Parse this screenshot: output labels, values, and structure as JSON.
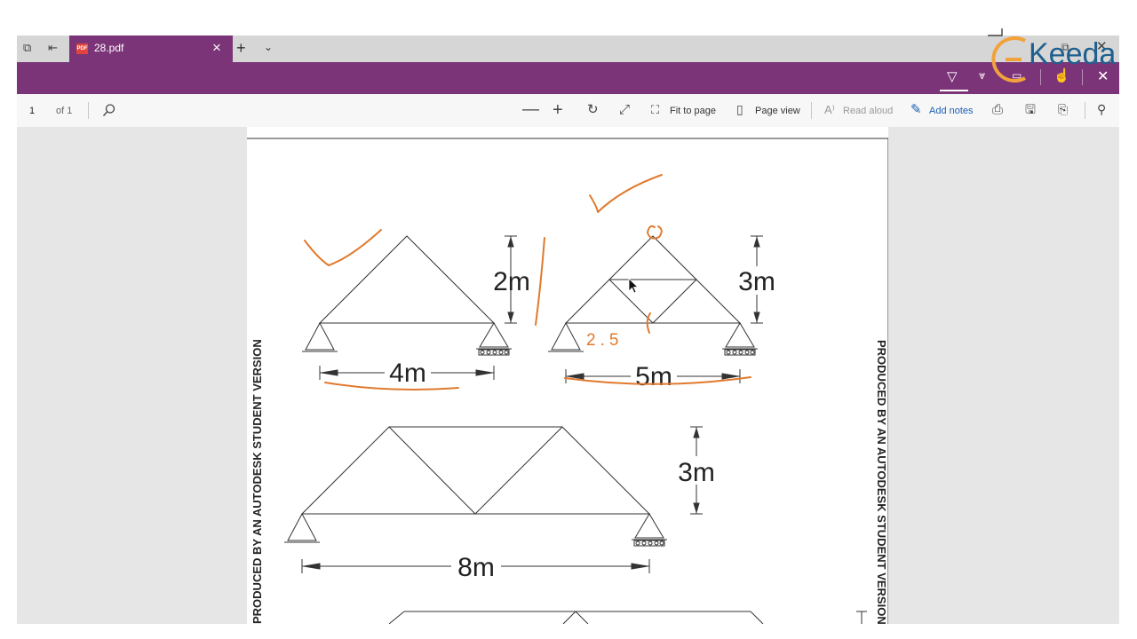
{
  "tab": {
    "title": "28.pdf",
    "pdf_badge": "PDF"
  },
  "toolbar": {
    "page_number": "1",
    "page_total": "of 1",
    "fit_to_page": "Fit to page",
    "page_view": "Page view",
    "read_aloud": "Read aloud",
    "add_notes": "Add notes"
  },
  "watermark": {
    "brand": "Keeda"
  },
  "drawing": {
    "truss1": {
      "span": "4m",
      "height": "2m"
    },
    "truss2": {
      "span": "5m",
      "height": "3m",
      "annotation": "2.5"
    },
    "truss3": {
      "span": "8m",
      "height": "3m"
    },
    "stamp_left": "PRODUCED BY AN AUTODESK STUDENT VERSION",
    "stamp_right": "PRODUCED BY AN AUTODESK STUDENT VERSION"
  },
  "colors": {
    "accent": "#7b3478",
    "ink": "#e07a2e",
    "viewer_bg": "#e6e6e6"
  }
}
